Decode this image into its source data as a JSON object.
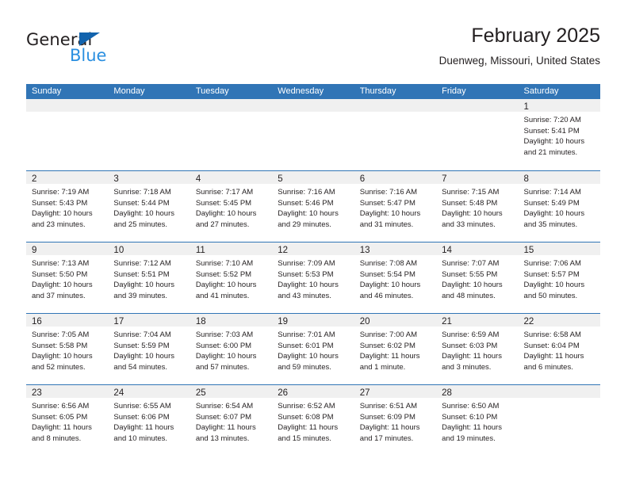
{
  "brand": {
    "word_general": "General",
    "word_blue": "Blue",
    "triangle_color": "#1263ad",
    "blue_color": "#2a8fe0"
  },
  "header": {
    "month_title": "February 2025",
    "location": "Duenweg, Missouri, United States"
  },
  "theme": {
    "header_blue": "#3175b6",
    "day_band_gray": "#f0f0f0",
    "text_color": "#231f20"
  },
  "weekday_headers": [
    "Sunday",
    "Monday",
    "Tuesday",
    "Wednesday",
    "Thursday",
    "Friday",
    "Saturday"
  ],
  "labels": {
    "sunrise_prefix": "Sunrise:",
    "sunset_prefix": "Sunset:",
    "daylight_prefix": "Daylight:"
  },
  "weeks": [
    [
      {
        "day": "",
        "empty": true
      },
      {
        "day": "",
        "empty": true
      },
      {
        "day": "",
        "empty": true
      },
      {
        "day": "",
        "empty": true
      },
      {
        "day": "",
        "empty": true
      },
      {
        "day": "",
        "empty": true
      },
      {
        "day": "1",
        "sunrise": "Sunrise: 7:20 AM",
        "sunset": "Sunset: 5:41 PM",
        "daylight_line1": "Daylight: 10 hours",
        "daylight_line2": "and 21 minutes."
      }
    ],
    [
      {
        "day": "2",
        "sunrise": "Sunrise: 7:19 AM",
        "sunset": "Sunset: 5:43 PM",
        "daylight_line1": "Daylight: 10 hours",
        "daylight_line2": "and 23 minutes."
      },
      {
        "day": "3",
        "sunrise": "Sunrise: 7:18 AM",
        "sunset": "Sunset: 5:44 PM",
        "daylight_line1": "Daylight: 10 hours",
        "daylight_line2": "and 25 minutes."
      },
      {
        "day": "4",
        "sunrise": "Sunrise: 7:17 AM",
        "sunset": "Sunset: 5:45 PM",
        "daylight_line1": "Daylight: 10 hours",
        "daylight_line2": "and 27 minutes."
      },
      {
        "day": "5",
        "sunrise": "Sunrise: 7:16 AM",
        "sunset": "Sunset: 5:46 PM",
        "daylight_line1": "Daylight: 10 hours",
        "daylight_line2": "and 29 minutes."
      },
      {
        "day": "6",
        "sunrise": "Sunrise: 7:16 AM",
        "sunset": "Sunset: 5:47 PM",
        "daylight_line1": "Daylight: 10 hours",
        "daylight_line2": "and 31 minutes."
      },
      {
        "day": "7",
        "sunrise": "Sunrise: 7:15 AM",
        "sunset": "Sunset: 5:48 PM",
        "daylight_line1": "Daylight: 10 hours",
        "daylight_line2": "and 33 minutes."
      },
      {
        "day": "8",
        "sunrise": "Sunrise: 7:14 AM",
        "sunset": "Sunset: 5:49 PM",
        "daylight_line1": "Daylight: 10 hours",
        "daylight_line2": "and 35 minutes."
      }
    ],
    [
      {
        "day": "9",
        "sunrise": "Sunrise: 7:13 AM",
        "sunset": "Sunset: 5:50 PM",
        "daylight_line1": "Daylight: 10 hours",
        "daylight_line2": "and 37 minutes."
      },
      {
        "day": "10",
        "sunrise": "Sunrise: 7:12 AM",
        "sunset": "Sunset: 5:51 PM",
        "daylight_line1": "Daylight: 10 hours",
        "daylight_line2": "and 39 minutes."
      },
      {
        "day": "11",
        "sunrise": "Sunrise: 7:10 AM",
        "sunset": "Sunset: 5:52 PM",
        "daylight_line1": "Daylight: 10 hours",
        "daylight_line2": "and 41 minutes."
      },
      {
        "day": "12",
        "sunrise": "Sunrise: 7:09 AM",
        "sunset": "Sunset: 5:53 PM",
        "daylight_line1": "Daylight: 10 hours",
        "daylight_line2": "and 43 minutes."
      },
      {
        "day": "13",
        "sunrise": "Sunrise: 7:08 AM",
        "sunset": "Sunset: 5:54 PM",
        "daylight_line1": "Daylight: 10 hours",
        "daylight_line2": "and 46 minutes."
      },
      {
        "day": "14",
        "sunrise": "Sunrise: 7:07 AM",
        "sunset": "Sunset: 5:55 PM",
        "daylight_line1": "Daylight: 10 hours",
        "daylight_line2": "and 48 minutes."
      },
      {
        "day": "15",
        "sunrise": "Sunrise: 7:06 AM",
        "sunset": "Sunset: 5:57 PM",
        "daylight_line1": "Daylight: 10 hours",
        "daylight_line2": "and 50 minutes."
      }
    ],
    [
      {
        "day": "16",
        "sunrise": "Sunrise: 7:05 AM",
        "sunset": "Sunset: 5:58 PM",
        "daylight_line1": "Daylight: 10 hours",
        "daylight_line2": "and 52 minutes."
      },
      {
        "day": "17",
        "sunrise": "Sunrise: 7:04 AM",
        "sunset": "Sunset: 5:59 PM",
        "daylight_line1": "Daylight: 10 hours",
        "daylight_line2": "and 54 minutes."
      },
      {
        "day": "18",
        "sunrise": "Sunrise: 7:03 AM",
        "sunset": "Sunset: 6:00 PM",
        "daylight_line1": "Daylight: 10 hours",
        "daylight_line2": "and 57 minutes."
      },
      {
        "day": "19",
        "sunrise": "Sunrise: 7:01 AM",
        "sunset": "Sunset: 6:01 PM",
        "daylight_line1": "Daylight: 10 hours",
        "daylight_line2": "and 59 minutes."
      },
      {
        "day": "20",
        "sunrise": "Sunrise: 7:00 AM",
        "sunset": "Sunset: 6:02 PM",
        "daylight_line1": "Daylight: 11 hours",
        "daylight_line2": "and 1 minute."
      },
      {
        "day": "21",
        "sunrise": "Sunrise: 6:59 AM",
        "sunset": "Sunset: 6:03 PM",
        "daylight_line1": "Daylight: 11 hours",
        "daylight_line2": "and 3 minutes."
      },
      {
        "day": "22",
        "sunrise": "Sunrise: 6:58 AM",
        "sunset": "Sunset: 6:04 PM",
        "daylight_line1": "Daylight: 11 hours",
        "daylight_line2": "and 6 minutes."
      }
    ],
    [
      {
        "day": "23",
        "sunrise": "Sunrise: 6:56 AM",
        "sunset": "Sunset: 6:05 PM",
        "daylight_line1": "Daylight: 11 hours",
        "daylight_line2": "and 8 minutes."
      },
      {
        "day": "24",
        "sunrise": "Sunrise: 6:55 AM",
        "sunset": "Sunset: 6:06 PM",
        "daylight_line1": "Daylight: 11 hours",
        "daylight_line2": "and 10 minutes."
      },
      {
        "day": "25",
        "sunrise": "Sunrise: 6:54 AM",
        "sunset": "Sunset: 6:07 PM",
        "daylight_line1": "Daylight: 11 hours",
        "daylight_line2": "and 13 minutes."
      },
      {
        "day": "26",
        "sunrise": "Sunrise: 6:52 AM",
        "sunset": "Sunset: 6:08 PM",
        "daylight_line1": "Daylight: 11 hours",
        "daylight_line2": "and 15 minutes."
      },
      {
        "day": "27",
        "sunrise": "Sunrise: 6:51 AM",
        "sunset": "Sunset: 6:09 PM",
        "daylight_line1": "Daylight: 11 hours",
        "daylight_line2": "and 17 minutes."
      },
      {
        "day": "28",
        "sunrise": "Sunrise: 6:50 AM",
        "sunset": "Sunset: 6:10 PM",
        "daylight_line1": "Daylight: 11 hours",
        "daylight_line2": "and 19 minutes."
      },
      {
        "day": "",
        "empty": true
      }
    ]
  ]
}
